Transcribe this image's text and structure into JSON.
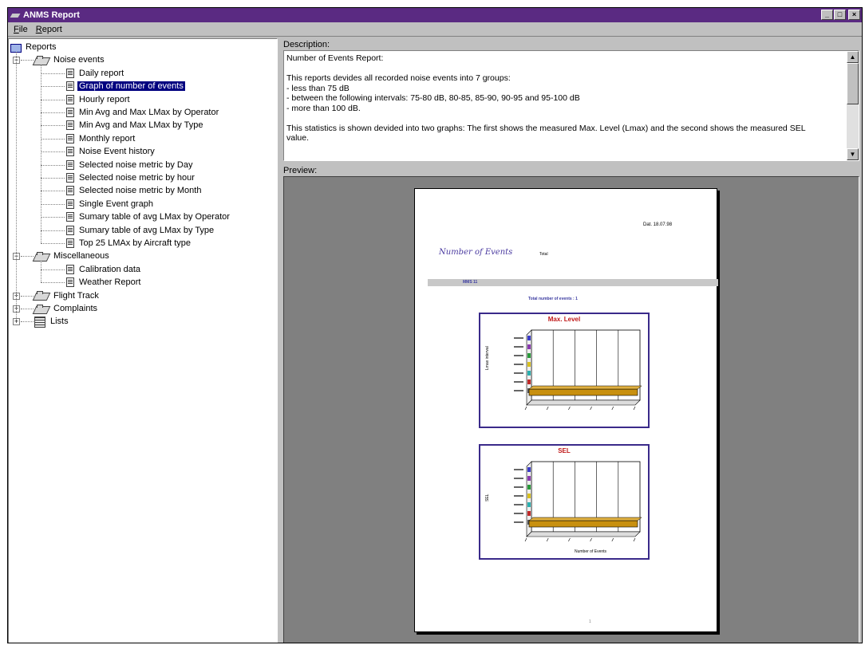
{
  "window": {
    "title": "ANMS Report",
    "buttons": [
      "_",
      "□",
      "×"
    ]
  },
  "menu": [
    {
      "label": "File",
      "hotkey": "F"
    },
    {
      "label": "Report",
      "hotkey": "R"
    }
  ],
  "tree": {
    "root": "Reports",
    "groups": [
      {
        "label": "Noise events",
        "expanded": true,
        "items": [
          "Daily report",
          "Graph of number of events",
          "Hourly report",
          "Min Avg and Max LMax by Operator",
          "Min Avg and Max LMax by Type",
          "Monthly report",
          "Noise Event history",
          "Selected noise metric by Day",
          "Selected noise metric by hour",
          "Selected noise metric by Month",
          "Single Event graph",
          "Sumary table of avg LMax by Operator",
          "Sumary table of avg LMax by Type",
          "Top 25 LMAx by Aircraft type"
        ]
      },
      {
        "label": "Miscellaneous",
        "expanded": true,
        "items": [
          "Calibration data",
          "Weather Report"
        ]
      },
      {
        "label": "Flight Track",
        "expanded": false,
        "items": []
      },
      {
        "label": "Complaints",
        "expanded": false,
        "items": []
      },
      {
        "label": "Lists",
        "expanded": false,
        "items": []
      }
    ],
    "selected": "Graph of number of events"
  },
  "description": {
    "label": "Description:",
    "lines": [
      "Number of Events Report:",
      "",
      "This reports devides all recorded noise events into 7 groups:",
      "- less than 75 dB",
      "- between the following intervals: 75-80 dB, 80-85, 85-90, 90-95 and 95-100 dB",
      "- more than 100 dB.",
      "",
      "This statistics is shown devided into two graphs: The first shows the measured Max. Level (Lmax) and the second shows the measured SEL",
      "value."
    ]
  },
  "preview": {
    "label": "Preview:",
    "page": {
      "date": "Dat. 18.07.98",
      "title": "Number of Events",
      "subtitle": "Total",
      "band_text": "MMS 11",
      "caption": "Total number of events : 1",
      "charts": [
        {
          "title": "Max. Level",
          "ylabel": "Lmax interval",
          "xlabel": "",
          "bar_value": 1,
          "bar_color": "#c8900f"
        },
        {
          "title": "SEL",
          "ylabel": "SEL",
          "xlabel": "Number of Events",
          "bar_value": 1,
          "bar_color": "#c8900f"
        }
      ],
      "footer": "1"
    }
  },
  "colors": {
    "titlebar": "#5a2a82",
    "selection": "#000080",
    "chart_border": "#3a2a8a",
    "chart_title": "#c01818",
    "bar": "#c8900f",
    "preview_bg": "#808080"
  }
}
